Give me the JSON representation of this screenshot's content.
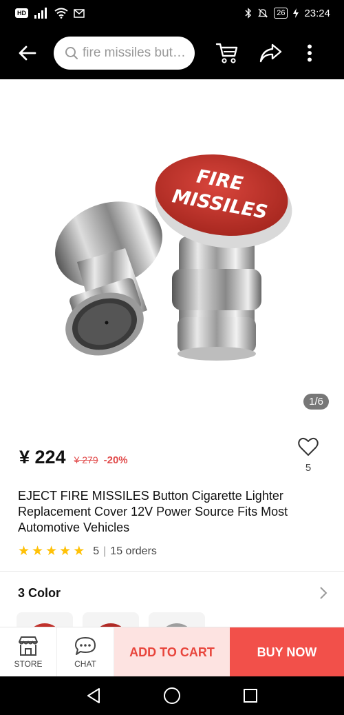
{
  "status_bar": {
    "hd_label": "HD",
    "battery": "26",
    "time": "23:24"
  },
  "top_bar": {
    "search_placeholder": "fire missiles butt..."
  },
  "product": {
    "image_text_line1": "FIRE",
    "image_text_line2": "MISSILES",
    "image_counter": "1/6",
    "price_current": "¥ 224",
    "price_old": "¥ 279",
    "discount": "-20%",
    "wishlist_count": "5",
    "title": "EJECT FIRE MISSILES Button Cigarette Lighter Replacement Cover 12V Power Source Fits Most Automotive Vehicles",
    "rating_value": "5",
    "rating_stars": 5,
    "orders": "15 orders",
    "colors_title": "3 Color"
  },
  "action_bar": {
    "store_label": "STORE",
    "chat_label": "CHAT",
    "add_to_cart_label": "ADD TO CART",
    "buy_now_label": "BUY NOW"
  },
  "colors": {
    "accent_red": "#f2504a",
    "button_red": "#c0312b",
    "star_yellow": "#ffc107"
  }
}
